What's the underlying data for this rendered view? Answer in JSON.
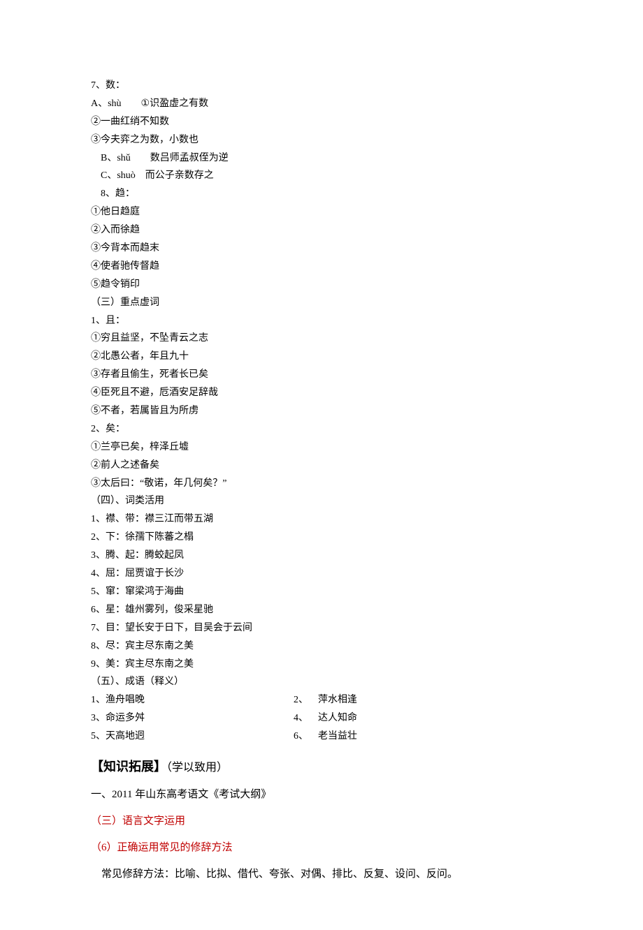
{
  "items": {
    "i7_title": "7、数：",
    "i7_a": "A、shù  ①识盈虚之有数",
    "i7_a2": "②一曲红绡不知数",
    "i7_a3": "③今夫弈之为数，小数也",
    "i7_b": "B、shǔ  数吕师孟叔侄为逆",
    "i7_c": "C、shuò 而公子亲数存之",
    "i8_title": "8、趋：",
    "i8_1": "①他日趋庭",
    "i8_2": "②入而徐趋",
    "i8_3": "③今背本而趋末",
    "i8_4": "④使者驰传督趋",
    "i8_5": "⑤趋令销印",
    "sec3": "（三）重点虚词",
    "q1_title": "1、且：",
    "q1_1": "①穷且益坚，不坠青云之志",
    "q1_2": "②北愚公者，年且九十",
    "q1_3": "③存者且偷生，死者长已矣",
    "q1_4": "④臣死且不避，卮酒安足辞哉",
    "q1_5": "⑤不者，若属皆且为所虏",
    "y2_title": "2、矣：",
    "y2_1": "①兰亭已矣，梓泽丘墟",
    "y2_2": "②前人之述备矣",
    "y2_3": "③太后曰：“敬诺，年几何矣？”",
    "sec4": "（四）、词类活用",
    "w1": "1、襟、带：襟三江而带五湖",
    "w2": "2、下：徐孺下陈蕃之榻",
    "w3": "3、腾、起：腾蛟起凤",
    "w4": "4、屈：屈贾谊于长沙",
    "w5": "5、窜：窜梁鸿于海曲",
    "w6": "6、星：雄州雾列，俊采星驰",
    "w7": "7、目：望长安于日下，目吴会于云间",
    "w8": "8、尽：宾主尽东南之美",
    "w9": "9、美：宾主尽东南之美",
    "sec5": "（五）、成语（释义）",
    "c1l": "1、渔舟唱晚",
    "c1r": "2、 萍水相逢",
    "c2l": "3、命运多舛",
    "c2r": "4、 达人知命",
    "c3l": "5、天高地迥",
    "c3r": "6、 老当益壮"
  },
  "expand": {
    "header_bold": "【知识拓展】",
    "header_paren": "（学以致用）",
    "line1": "一、2011 年山东高考语文《考试大纲》",
    "line2": "（三）语言文字运用",
    "line3": "（6）正确运用常见的修辞方法",
    "line4": "常见修辞方法：比喻、比拟、借代、夸张、对偶、排比、反复、设问、反问。"
  }
}
